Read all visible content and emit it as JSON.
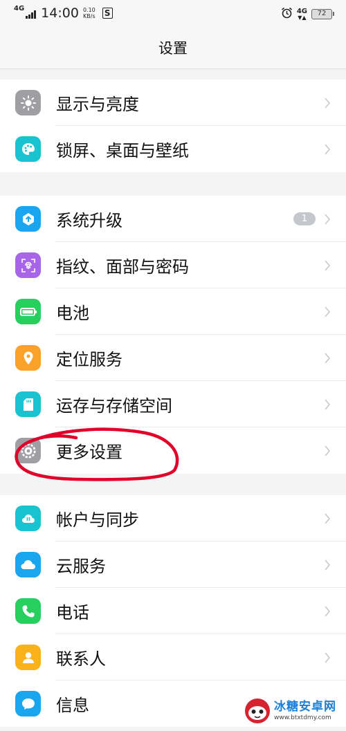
{
  "status_bar": {
    "network": "4G",
    "time": "14:00",
    "speed_value": "0.10",
    "speed_unit": "KB/s",
    "sim_badge": "S",
    "right_network": "4G",
    "battery": "72"
  },
  "header": {
    "title": "设置"
  },
  "groups": [
    {
      "items": [
        {
          "label": "显示与亮度",
          "icon": "brightness-icon",
          "color": "#9e9ea3"
        },
        {
          "label": "锁屏、桌面与壁纸",
          "icon": "palette-icon",
          "color": "#19c3cf"
        }
      ]
    },
    {
      "items": [
        {
          "label": "系统升级",
          "icon": "system-update-icon",
          "color": "#1aa6ef",
          "badge": "1"
        },
        {
          "label": "指纹、面部与密码",
          "icon": "fingerprint-icon",
          "color": "#a766e8"
        },
        {
          "label": "电池",
          "icon": "battery-icon",
          "color": "#26cf5e"
        },
        {
          "label": "定位服务",
          "icon": "location-icon",
          "color": "#f9a128"
        },
        {
          "label": "运存与存储空间",
          "icon": "sd-card-icon",
          "color": "#19c3cf"
        },
        {
          "label": "更多设置",
          "icon": "gear-icon",
          "color": "#9e9ea3"
        }
      ]
    },
    {
      "items": [
        {
          "label": "帐户与同步",
          "icon": "account-sync-icon",
          "color": "#19c3cf"
        },
        {
          "label": "云服务",
          "icon": "cloud-icon",
          "color": "#1aa6ef"
        },
        {
          "label": "电话",
          "icon": "phone-icon",
          "color": "#26cf5e"
        },
        {
          "label": "联系人",
          "icon": "contact-icon",
          "color": "#f9b21c"
        },
        {
          "label": "信息",
          "icon": "message-icon",
          "color": "#1aa6ef"
        }
      ]
    }
  ],
  "annotation_color": "#e0002a",
  "watermark": {
    "name": "冰糖安卓网",
    "url": "www.btxtdmy.com"
  }
}
